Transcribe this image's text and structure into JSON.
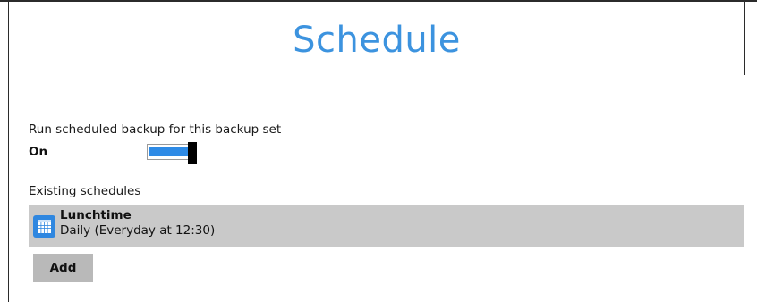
{
  "page": {
    "title": "Schedule"
  },
  "run_scheduled": {
    "label": "Run scheduled backup for this backup set",
    "state_label": "On",
    "enabled": true,
    "toggle_color": "#2e8be6"
  },
  "existing": {
    "label": "Existing schedules",
    "items": [
      {
        "icon": "calendar-icon",
        "name": "Lunchtime",
        "description": "Daily (Everyday at 12:30)"
      }
    ]
  },
  "actions": {
    "add_label": "Add"
  },
  "colors": {
    "title": "#3c93df",
    "row_background": "#c9c9c9",
    "icon_background": "#2f87e0",
    "button_background": "#b9b9b9"
  }
}
